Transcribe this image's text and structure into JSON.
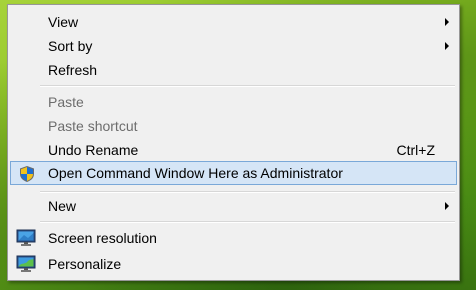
{
  "menu": {
    "view": {
      "label": "View"
    },
    "sort_by": {
      "label": "Sort by"
    },
    "refresh": {
      "label": "Refresh"
    },
    "paste": {
      "label": "Paste"
    },
    "paste_shortcut": {
      "label": "Paste shortcut"
    },
    "undo_rename": {
      "label": "Undo Rename",
      "shortcut": "Ctrl+Z"
    },
    "open_cmd_admin": {
      "label": "Open Command Window Here as Administrator",
      "icon": "uac-shield-icon"
    },
    "new": {
      "label": "New"
    },
    "screen_resolution": {
      "label": "Screen resolution",
      "icon": "monitor-icon"
    },
    "personalize": {
      "label": "Personalize",
      "icon": "personalize-icon"
    }
  },
  "colors": {
    "menu_background": "#f0f0f0",
    "highlight_background": "#d5e5f6",
    "highlight_border": "#7aa8d8",
    "disabled_text": "#6d6d6d",
    "wallpaper": "#8cc223"
  }
}
